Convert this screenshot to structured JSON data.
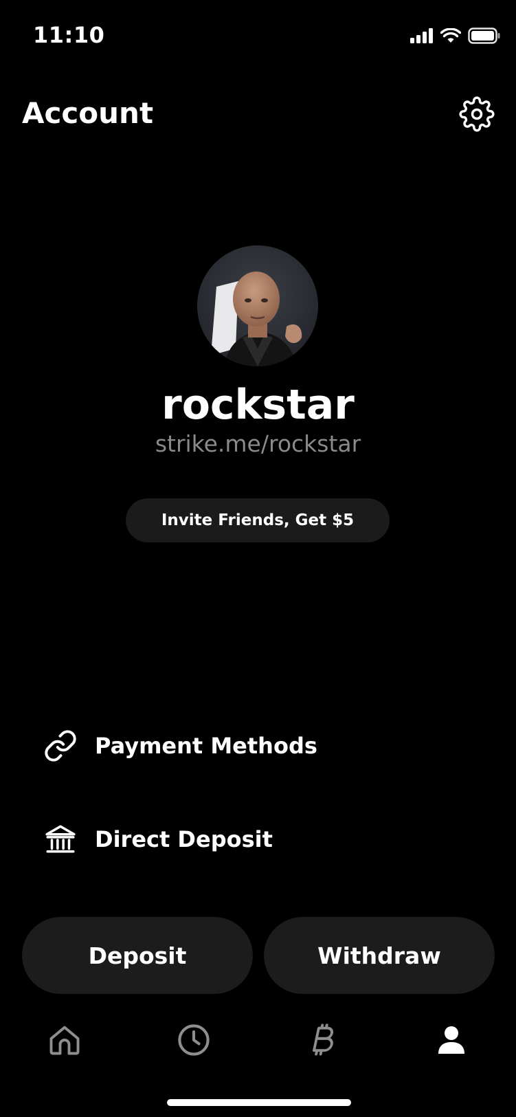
{
  "status_bar": {
    "time": "11:10"
  },
  "header": {
    "title": "Account"
  },
  "profile": {
    "username": "rockstar",
    "link": "strike.me/rockstar"
  },
  "invite": {
    "label": "Invite Friends, Get $5"
  },
  "menu": {
    "items": [
      {
        "label": "Payment Methods",
        "icon": "link-icon"
      },
      {
        "label": "Direct Deposit",
        "icon": "bank-icon"
      }
    ]
  },
  "actions": {
    "deposit_label": "Deposit",
    "withdraw_label": "Withdraw"
  },
  "tabs": [
    {
      "name": "home",
      "icon": "home-icon",
      "active": false
    },
    {
      "name": "history",
      "icon": "clock-icon",
      "active": false
    },
    {
      "name": "bitcoin",
      "icon": "bitcoin-icon",
      "active": false
    },
    {
      "name": "account",
      "icon": "person-icon",
      "active": true
    }
  ],
  "colors": {
    "background": "#000000",
    "surface": "#1c1c1c",
    "text": "#ffffff",
    "muted_text": "#8a8a8a",
    "inactive_icon": "#8e8e8e"
  }
}
